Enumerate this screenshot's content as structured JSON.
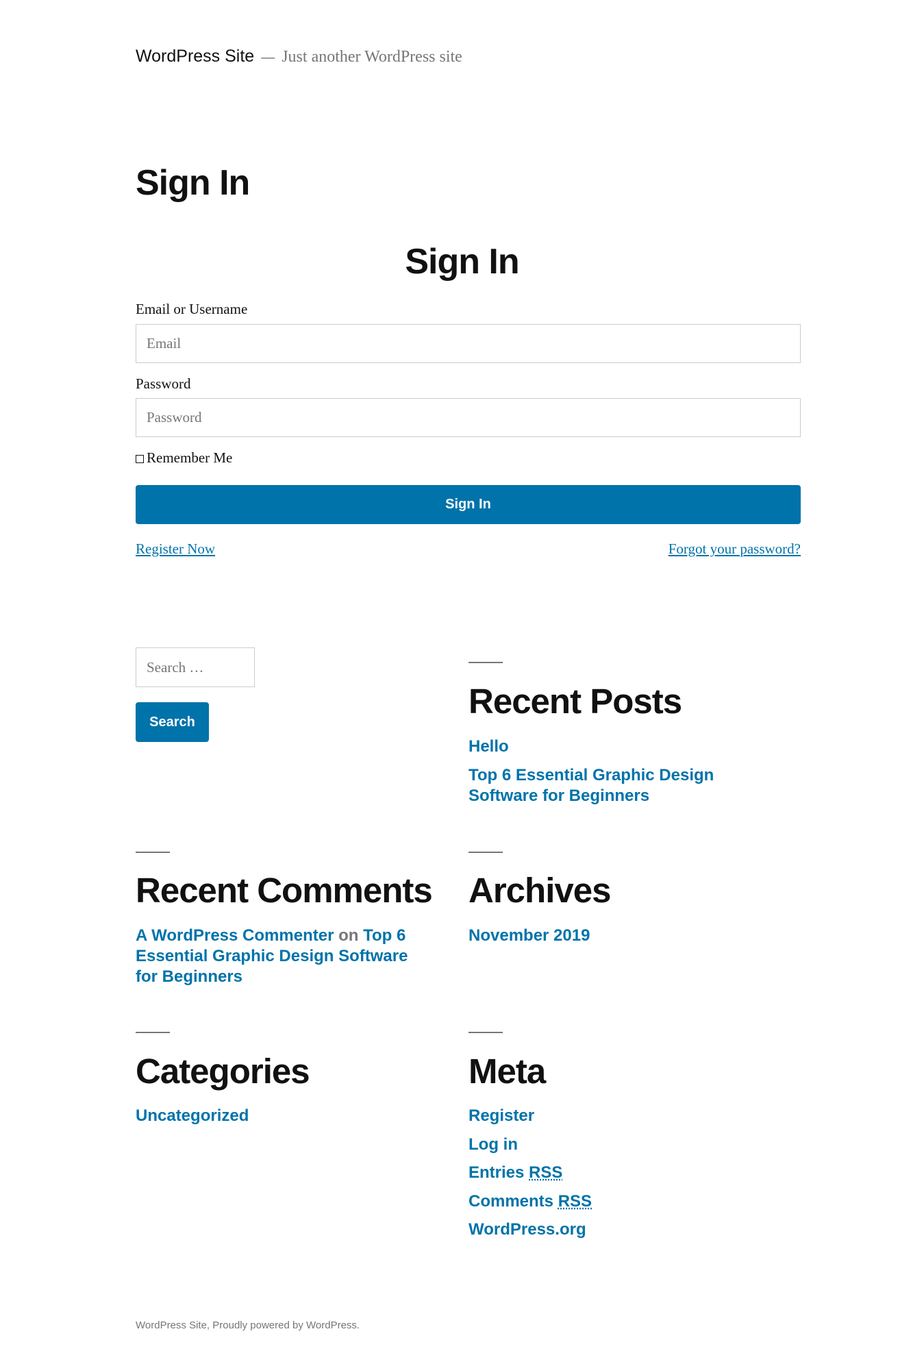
{
  "header": {
    "site_title": "WordPress Site",
    "separator": "—",
    "tagline": "Just another WordPress site"
  },
  "page": {
    "title": "Sign In"
  },
  "form": {
    "title": "Sign In",
    "email_label": "Email or Username",
    "email_placeholder": "Email",
    "password_label": "Password",
    "password_placeholder": "Password",
    "remember_label": "Remember Me",
    "submit_label": "Sign In",
    "register_link": "Register Now",
    "forgot_link": "Forgot your password?"
  },
  "search": {
    "placeholder": "Search …",
    "button": "Search"
  },
  "widgets": {
    "recent_posts": {
      "title": "Recent Posts",
      "items": [
        "Hello",
        "Top 6 Essential Graphic Design Software for Beginners"
      ]
    },
    "recent_comments": {
      "title": "Recent Comments",
      "author": "A WordPress Commenter",
      "on": "on",
      "post": "Top 6 Essential Graphic Design Software for Beginners"
    },
    "archives": {
      "title": "Archives",
      "items": [
        "November 2019"
      ]
    },
    "categories": {
      "title": "Categories",
      "items": [
        "Uncategorized"
      ]
    },
    "meta": {
      "title": "Meta",
      "register": "Register",
      "login": "Log in",
      "entries": "Entries",
      "comments": "Comments",
      "rss": "RSS",
      "wporg": "WordPress.org"
    }
  },
  "footer": {
    "text": "WordPress Site, Proudly powered by WordPress."
  },
  "colors": {
    "accent": "#0073aa",
    "text": "#111111",
    "muted": "#767676"
  }
}
